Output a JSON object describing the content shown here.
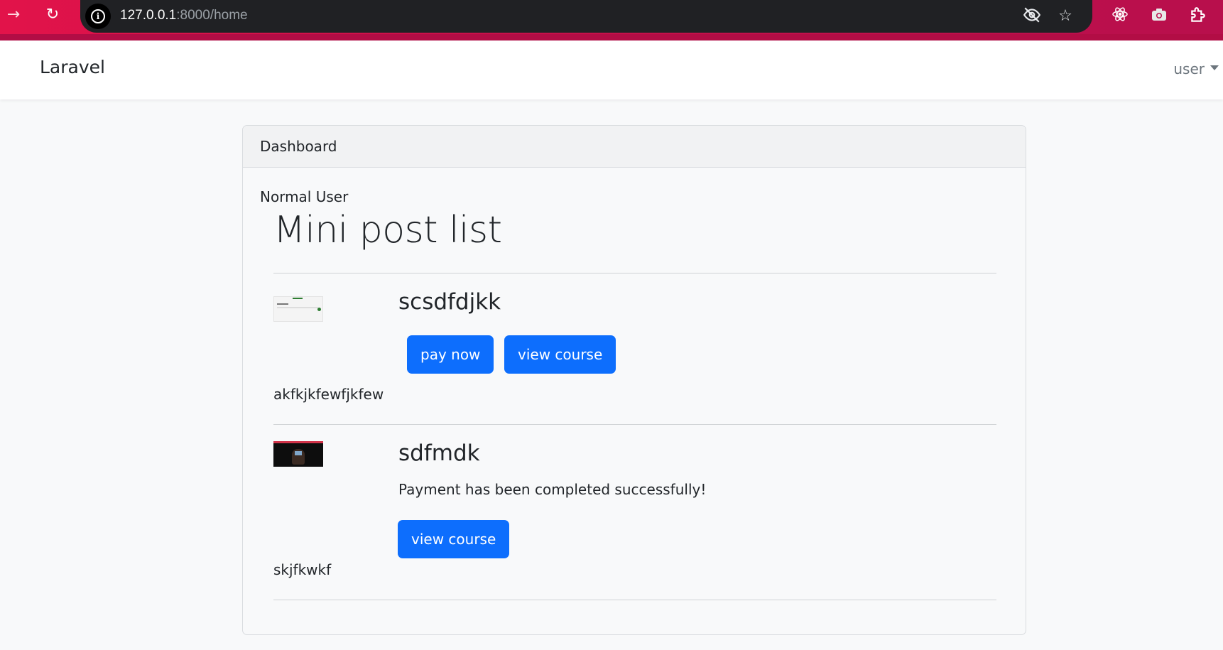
{
  "browser": {
    "url_host": "127.0.0.1",
    "url_path": ":8000/home",
    "icons": [
      "forward-icon",
      "reload-icon",
      "site-info-icon",
      "eye-off-icon",
      "star-icon",
      "react-devtools-icon",
      "camera-icon",
      "extensions-icon"
    ]
  },
  "navbar": {
    "brand": "Laravel",
    "user_label": "user"
  },
  "card": {
    "header": "Dashboard",
    "role_text": "Normal User",
    "list_title": "Mini post list"
  },
  "posts": [
    {
      "title": "scsdfdjkk",
      "description": "akfkjkfewfjkfew",
      "pay_button": "pay now",
      "view_button": "view course"
    },
    {
      "title": "sdfmdk",
      "status_message": "Payment has been completed successfully!",
      "view_button": "view course",
      "description": "skjfkwkf"
    }
  ],
  "colors": {
    "browser_bar": "#e2134a",
    "omnibox": "#202124",
    "primary_button": "#0d6efd",
    "page_background": "#f8f9fa"
  }
}
